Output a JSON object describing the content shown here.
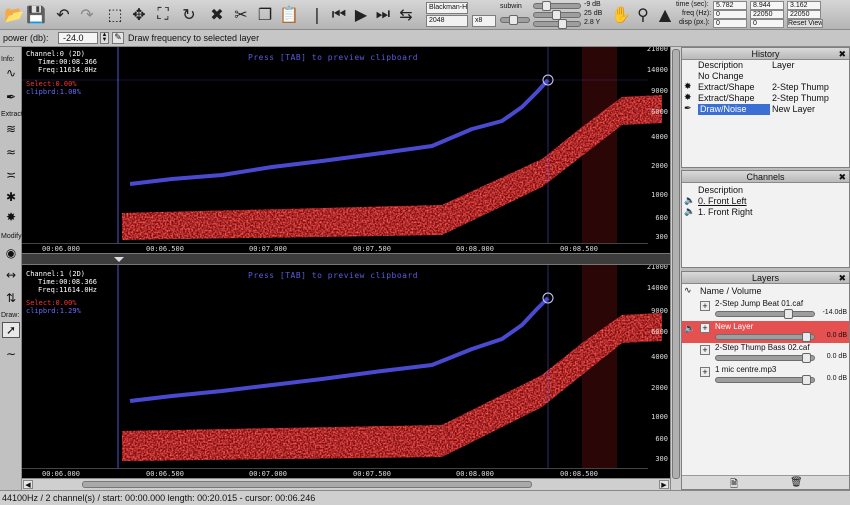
{
  "toolbar": {
    "window_label": "Blackman-H",
    "fft_size": "2048",
    "oversample": "x8",
    "subwin_label": "subwin",
    "db_top": "-9 dB",
    "db_range": "25 dB",
    "db_gamma": "2.8 Y",
    "time_label": "time (sec):",
    "freq_label": "freq (Hz):",
    "disp_label": "disp (px.):",
    "time_vals": [
      "5.782",
      "8.944",
      "3.162"
    ],
    "freq_vals": [
      "0",
      "22050",
      "22050"
    ],
    "disp_vals": [
      "0",
      "0"
    ],
    "reset_label": "Reset View",
    "icons": [
      "open-folder-icon",
      "save-icon",
      "undo-icon",
      "redo-icon",
      "rect-select-icon",
      "move-icon",
      "zoom-icon",
      "loop-icon",
      "delete-icon",
      "cut-icon",
      "copy-icon",
      "paste-icon",
      "cursor-icon",
      "skip-start-icon",
      "play-icon",
      "skip-end-icon",
      "swap-icon"
    ]
  },
  "optbar": {
    "power_label": "power (db):",
    "power_value": "-24.0",
    "draw_label": "Draw frequency to selected layer"
  },
  "left_tools": {
    "info": "Info:",
    "extract": "Extract:",
    "modify": "Modify:",
    "draw": "Draw:"
  },
  "spectrogram": {
    "clip_text": "Press [TAB] to preview clipboard",
    "channels": [
      {
        "line1": "Channel:0 (2D)",
        "line2": "Time:00:08.366",
        "line3": "Freq:11614.0Hz",
        "select": "Select:0.00%",
        "clipbrd": "clipbrd:1.08%"
      },
      {
        "line1": "Channel:1 (2D)",
        "line2": "Time:00:08.366",
        "line3": "Freq:11614.0Hz",
        "select": "Select:0.00%",
        "clipbrd": "clipbrd:1.29%"
      }
    ],
    "freq_ticks": [
      "21000",
      "14000",
      "9000",
      "6000",
      "4000",
      "2000",
      "1000",
      "600",
      "300"
    ],
    "time_ticks": [
      "00:06.000",
      "00:06.500",
      "00:07.000",
      "00:07.500",
      "00:08.000",
      "00:08.500"
    ]
  },
  "history": {
    "title": "History",
    "col_desc": "Description",
    "col_layer": "Layer",
    "rows": [
      {
        "desc": "No Change",
        "layer": ""
      },
      {
        "desc": "Extract/Shape",
        "layer": "2-Step Thump"
      },
      {
        "desc": "Extract/Shape",
        "layer": "2-Step Thump"
      },
      {
        "desc": "Draw/Noise",
        "layer": "New Layer"
      }
    ]
  },
  "channels": {
    "title": "Channels",
    "col_desc": "Description",
    "rows": [
      "0. Front Left",
      "1. Front Right"
    ]
  },
  "layers": {
    "title": "Layers",
    "col_name": "Name / Volume",
    "rows": [
      {
        "name": "2-Step Jump Beat 01.caf",
        "vol": "-14.0dB"
      },
      {
        "name": "New Layer",
        "vol": "0.0 dB"
      },
      {
        "name": "2-Step Thump Bass 02.caf",
        "vol": "0.0 dB"
      },
      {
        "name": "1 mic centre.mp3",
        "vol": "0.0 dB"
      }
    ]
  },
  "status": "44100Hz / 2 channel(s) / start: 00:00.000 length: 00:20.015 - cursor: 00:06.246"
}
